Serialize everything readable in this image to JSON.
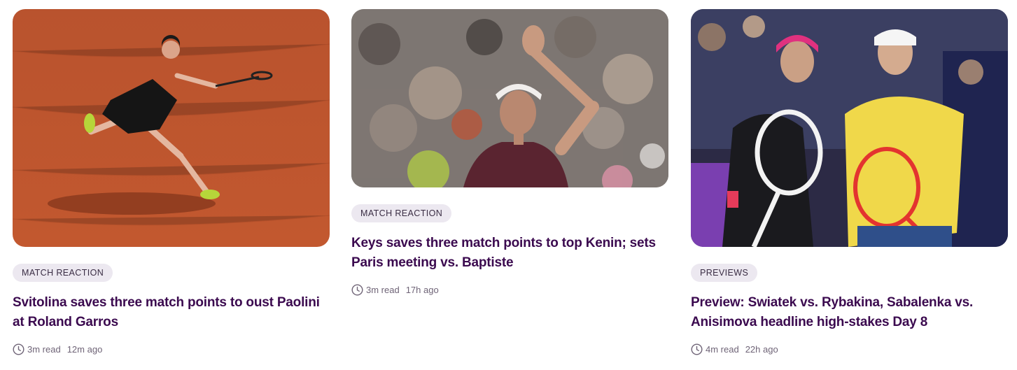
{
  "articles": [
    {
      "category": "MATCH REACTION",
      "title": "Svitolina saves three match points to oust Paolini at Roland Garros",
      "read_time": "3m read",
      "posted": "12m ago",
      "image": "clay-court-player-lunging-photo"
    },
    {
      "category": "MATCH REACTION",
      "title": "Keys saves three match points to top Kenin; sets Paris meeting vs. Baptiste",
      "read_time": "3m read",
      "posted": "17h ago",
      "image": "player-waving-to-crowd-photo"
    },
    {
      "category": "PREVIEWS",
      "title": "Preview: Swiatek vs. Rybakina, Sabalenka vs. Anisimova headline high-stakes Day 8",
      "read_time": "4m read",
      "posted": "22h ago",
      "image": "two-players-posing-with-rackets-photo"
    }
  ],
  "colors": {
    "title": "#3b0a4f",
    "tag_bg": "#ece8f0",
    "meta": "#6f6477"
  }
}
